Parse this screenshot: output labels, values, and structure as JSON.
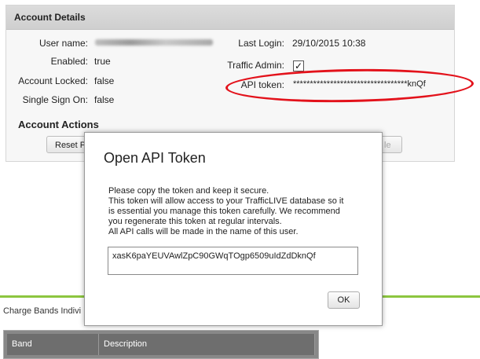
{
  "panel": {
    "title": "Account Details",
    "fields": {
      "user_name_label": "User name:",
      "enabled_label": "Enabled:",
      "enabled_value": "true",
      "account_locked_label": "Account Locked:",
      "account_locked_value": "false",
      "sso_label": "Single Sign On:",
      "sso_value": "false",
      "last_login_label": "Last Login:",
      "last_login_value": "29/10/2015 10:38",
      "traffic_admin_label": "Traffic Admin:",
      "traffic_admin_checked": "✓",
      "api_token_label": "API token:",
      "api_token_value": "**********************************knQf"
    },
    "actions_title": "Account Actions",
    "reset_button_label": "Reset P",
    "right_button_label": "le"
  },
  "below": {
    "charge_bands_label": "Charge Bands Indivi",
    "table_headers": [
      "Band",
      "Description"
    ]
  },
  "modal": {
    "title": "Open API Token",
    "lines": [
      "Please copy the token and keep it secure.",
      "This token will allow access to your TrafficLIVE database so it",
      "is essential you manage this token carefully. We recommend",
      "you regenerate this token at regular intervals.",
      "All API calls will be made in the name of this user."
    ],
    "token": "xasK6paYEUVAwlZpC90GWqTOgp6509uIdZdDknQf",
    "ok_label": "OK"
  },
  "colors": {
    "accent_green": "#8cc63f",
    "highlight_red": "#e3121b"
  }
}
